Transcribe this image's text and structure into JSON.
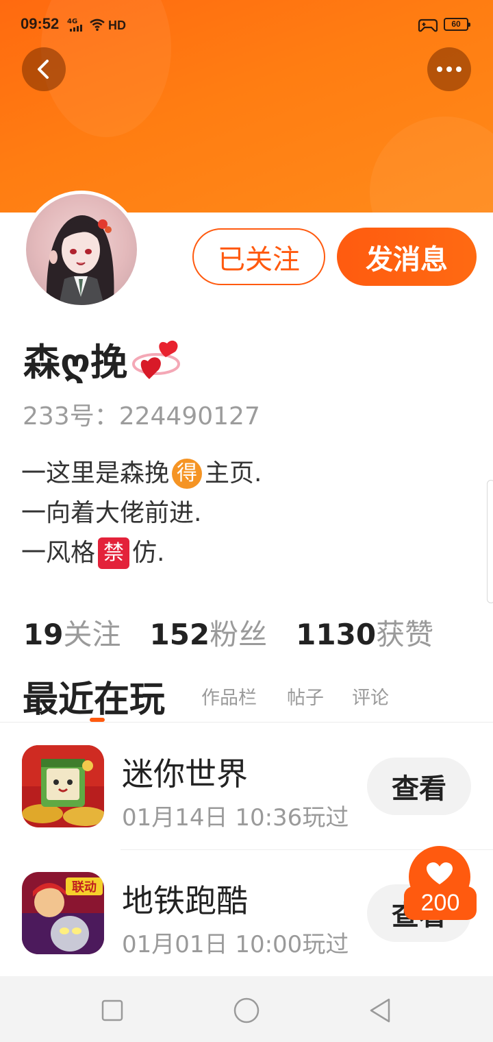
{
  "status_bar": {
    "time": "09:52",
    "network": "4G",
    "hd": "HD",
    "battery": "60"
  },
  "header": {
    "back_icon": "chevron-left-icon",
    "more_icon": "more-dots-icon",
    "accent": "#ff6a10"
  },
  "profile": {
    "followed_label": "已关注",
    "message_label": "发消息",
    "name": "森ღ挽",
    "id_text": "233号：224490127",
    "bio": {
      "line1_a": "一这里是森挽",
      "line1_badge": "得",
      "line1_b": "主页.",
      "line2": "一向着大佬前进.",
      "line3_a": "一风格",
      "line3_badge": "禁",
      "line3_b": "仿."
    }
  },
  "stats": [
    {
      "num": "19",
      "label": "关注"
    },
    {
      "num": "152",
      "label": "粉丝"
    },
    {
      "num": "1130",
      "label": "获赞"
    }
  ],
  "tabs": {
    "active": "最近在玩",
    "items": [
      "作品栏",
      "帖子",
      "评论"
    ]
  },
  "games": [
    {
      "title": "迷你世界",
      "time": "01月14日 10:36玩过",
      "button": "查看"
    },
    {
      "title": "地铁跑酷",
      "time": "01月01日 10:00玩过",
      "button": "查看",
      "badge": "联动"
    }
  ],
  "like_float": {
    "count": "200",
    "icon": "heart-icon"
  },
  "nav_bar": {
    "icons": [
      "square-icon",
      "circle-icon",
      "triangle-back-icon"
    ]
  }
}
